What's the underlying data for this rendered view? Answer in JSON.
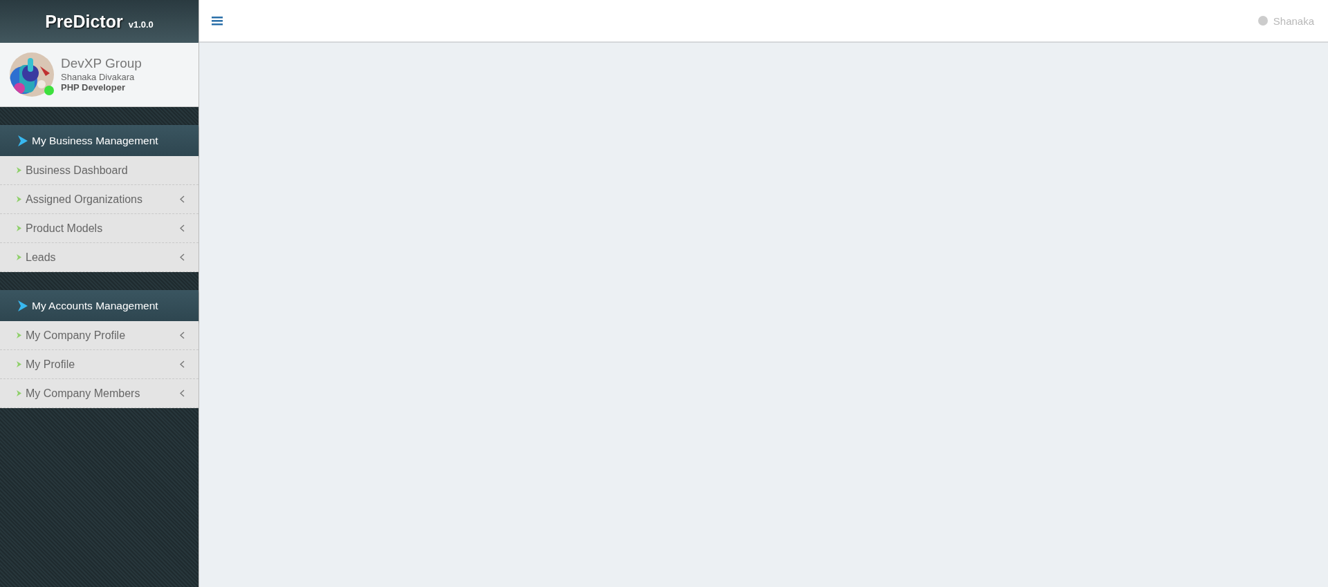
{
  "brand": {
    "title": "PreDictor",
    "version": "v1.0.0"
  },
  "profile": {
    "organization": "DevXP Group",
    "name": "Shanaka Divakara",
    "role": "PHP Developer",
    "online": true
  },
  "sidebar": {
    "sections": [
      {
        "title": "My Business Management",
        "items": [
          {
            "label": "Business Dashboard",
            "has_submenu": false
          },
          {
            "label": "Assigned Organizations",
            "has_submenu": true
          },
          {
            "label": "Product Models",
            "has_submenu": true
          },
          {
            "label": "Leads",
            "has_submenu": true
          }
        ]
      },
      {
        "title": "My Accounts Management",
        "items": [
          {
            "label": "My Company Profile",
            "has_submenu": true
          },
          {
            "label": "My Profile",
            "has_submenu": true
          },
          {
            "label": "My Company Members",
            "has_submenu": true
          }
        ]
      }
    ]
  },
  "top_bar": {
    "user_name": "Shanaka"
  }
}
